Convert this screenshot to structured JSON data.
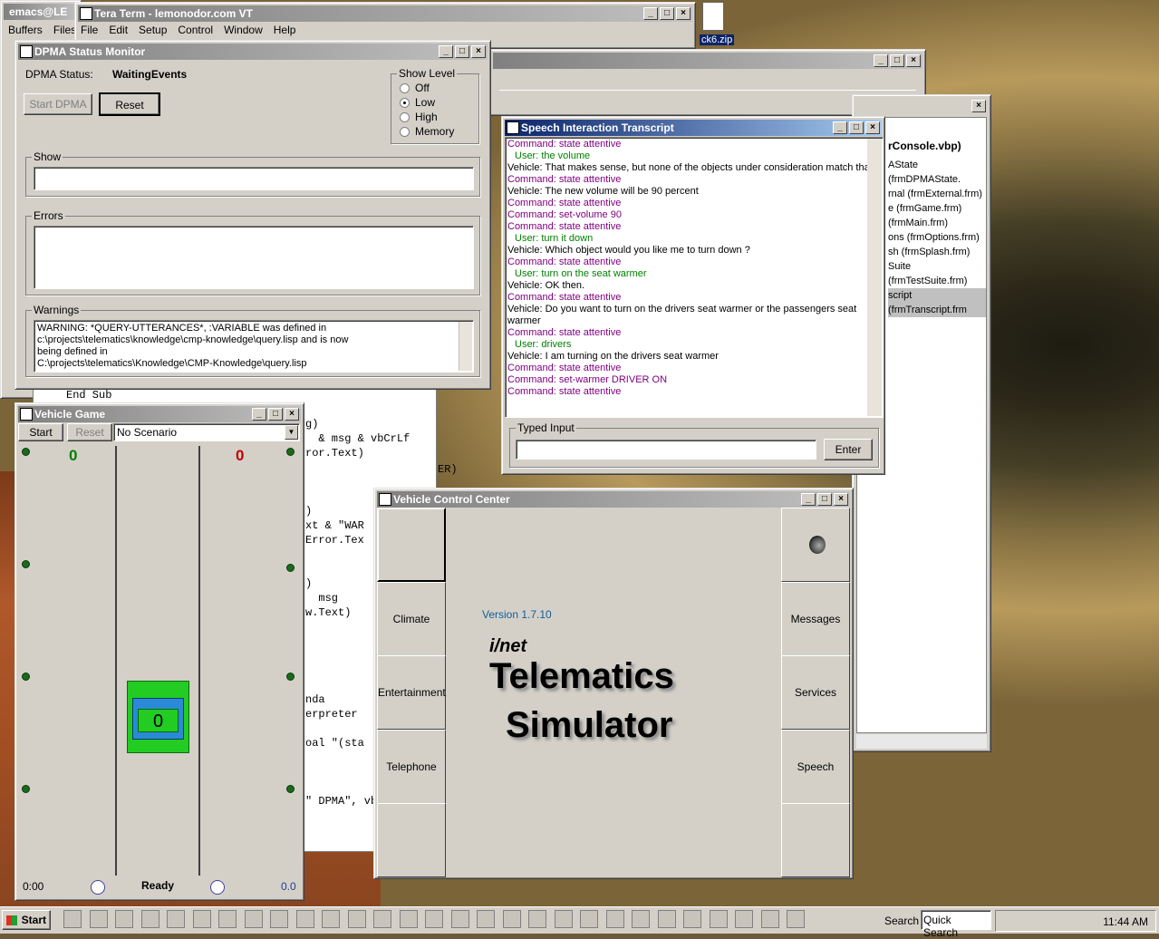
{
  "emacs": {
    "title": "emacs@LE",
    "menu": [
      "Buffers",
      "Files"
    ]
  },
  "tera": {
    "title": "Tera Term - lemonodor.com VT",
    "menu": [
      "File",
      "Edit",
      "Setup",
      "Control",
      "Window",
      "Help"
    ]
  },
  "desktop": {
    "zip_label": "ck6.zip"
  },
  "dpma": {
    "title": "DPMA Status Monitor",
    "status_label": "DPMA Status:",
    "status_value": "WaitingEvents",
    "start_label": "Start DPMA",
    "reset_label": "Reset",
    "show_level_label": "Show Level",
    "levels": [
      "Off",
      "Low",
      "High",
      "Memory"
    ],
    "selected_level": "Low",
    "show_label": "Show",
    "errors_label": "Errors",
    "warnings_label": "Warnings",
    "warning_lines": [
      "WARNING: *QUERY-UTTERANCES*, :VARIABLE was defined in",
      "c:\\projects\\telematics\\knowledge\\cmp-knowledge\\query.lisp and is now",
      "being defined in",
      "C:\\projects\\telematics\\Knowledge\\CMP-Knowledge\\query.lisp"
    ]
  },
  "project": {
    "title_tail": "rConsole.vbp)",
    "items": [
      "AState (frmDPMAState.",
      "rnal (frmExternal.frm)",
      "e (frmGame.frm)",
      "(frmMain.frm)",
      "ons (frmOptions.frm)",
      "sh (frmSplash.frm)",
      "Suite (frmTestSuite.frm)",
      "script (frmTranscript.frm"
    ]
  },
  "transcript": {
    "title": "Speech Interaction Transcript",
    "lines": [
      {
        "t": "cmd",
        "x": "Command: state attentive"
      },
      {
        "t": "usr",
        "x": "User: the volume"
      },
      {
        "t": "veh",
        "x": "Vehicle: That makes sense, but none of the objects under consideration match that."
      },
      {
        "t": "cmd",
        "x": "Command: state attentive"
      },
      {
        "t": "veh",
        "x": "Vehicle: The new volume will be 90 percent"
      },
      {
        "t": "cmd",
        "x": "Command: state attentive"
      },
      {
        "t": "cmd",
        "x": "Command: set-volume 90"
      },
      {
        "t": "cmd",
        "x": "Command: state attentive"
      },
      {
        "t": "usr",
        "x": "User: turn it down"
      },
      {
        "t": "veh",
        "x": "Vehicle: Which object would you like me to turn down ?"
      },
      {
        "t": "cmd",
        "x": "Command: state attentive"
      },
      {
        "t": "usr",
        "x": "User: turn on the seat warmer"
      },
      {
        "t": "veh",
        "x": "Vehicle: OK then."
      },
      {
        "t": "cmd",
        "x": "Command: state attentive"
      },
      {
        "t": "veh",
        "x": "Vehicle: Do you want to turn on  the drivers seat warmer or the passengers seat"
      },
      {
        "t": "veh",
        "x": "warmer"
      },
      {
        "t": "cmd",
        "x": "Command: state attentive"
      },
      {
        "t": "usr",
        "x": "User: drivers"
      },
      {
        "t": "veh",
        "x": "Vehicle: I am turning on the drivers seat warmer"
      },
      {
        "t": "cmd",
        "x": "Command: state attentive"
      },
      {
        "t": "cmd",
        "x": "Command: set-warmer DRIVER ON"
      },
      {
        "t": "cmd",
        "x": "Command: state attentive"
      }
    ],
    "typed_input_label": "Typed Input",
    "enter_label": "Enter"
  },
  "code": {
    "lines": [
      "End Sub",
      "g)",
      "  & msg & vbCrLf",
      "ror.Text)",
      "ER)",
      ")",
      "xt & \"WAR",
      "Error.Tex",
      ")",
      "  msg",
      "w.Text)",
      "nda",
      "erpreter",
      "oal \"(sta",
      "\" DPMA\", vb"
    ]
  },
  "game": {
    "title": "Vehicle Game",
    "start_label": "Start",
    "reset_label": "Reset",
    "scenario": "No Scenario",
    "score_left": "0",
    "score_right": "0",
    "car_value": "0",
    "time": "0:00",
    "status": "Ready",
    "speed": "0.0"
  },
  "vcc": {
    "title": "Vehicle Control Center",
    "left_buttons": [
      "",
      "Climate",
      "Entertainment",
      "Telephone",
      ""
    ],
    "right_buttons": [
      "",
      "Messages",
      "Services",
      "Speech",
      ""
    ],
    "version": "Version 1.7.10",
    "brand": "i/net",
    "product_line1": "Telematics",
    "product_line2": "Simulator"
  },
  "taskbar": {
    "start_label": "Start",
    "search_label": "Search",
    "search_value": "Quick Search",
    "clock": "11:44 AM"
  },
  "colors": {
    "title_active": "#0a246a",
    "title_inactive": "#808080",
    "command": "#800080",
    "user": "#008000",
    "version": "#1060a0",
    "score_left": "#008000",
    "score_right": "#c00000"
  }
}
